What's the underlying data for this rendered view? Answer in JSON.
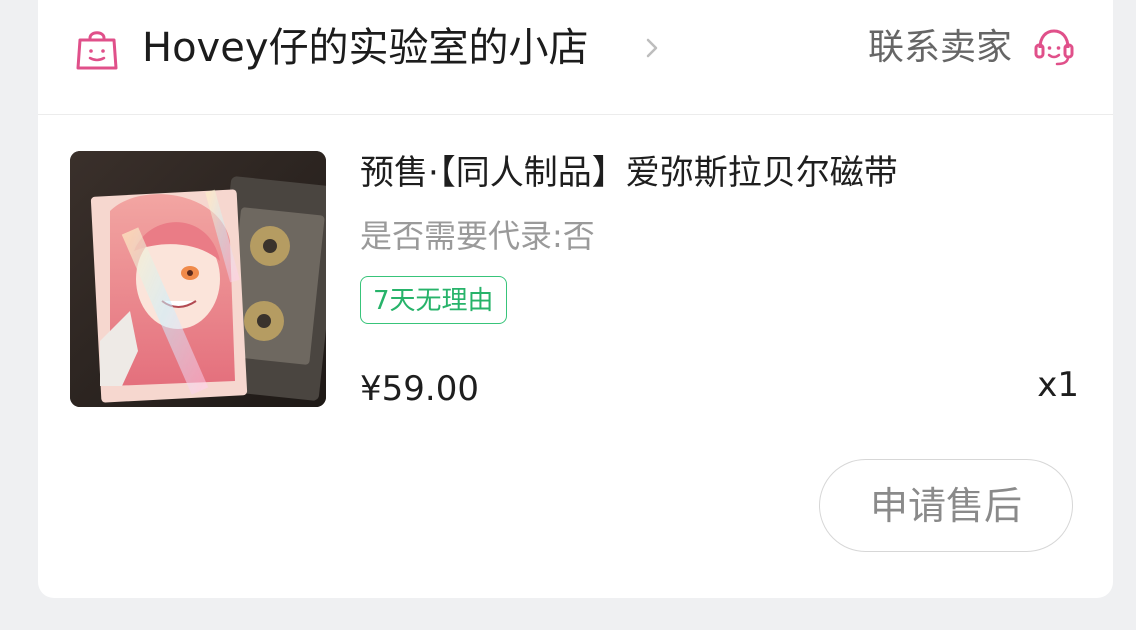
{
  "shop": {
    "name": "Hovey仔的实验室的小店",
    "contact_label": "联系卖家",
    "icons": {
      "shop": "shopping-bag-icon",
      "chevron": "chevron-right-icon",
      "support": "customer-service-icon"
    },
    "accent_color": "#e0508a"
  },
  "product": {
    "title": "预售·【同人制品】爱弥斯拉贝尔磁带",
    "spec": "是否需要代录:否",
    "return_badge": "7天无理由",
    "price": "¥59.00",
    "quantity": "x1",
    "image": "product-thumbnail-illustration",
    "badge_color": "#27b36a"
  },
  "actions": {
    "after_sale_label": "申请售后"
  }
}
